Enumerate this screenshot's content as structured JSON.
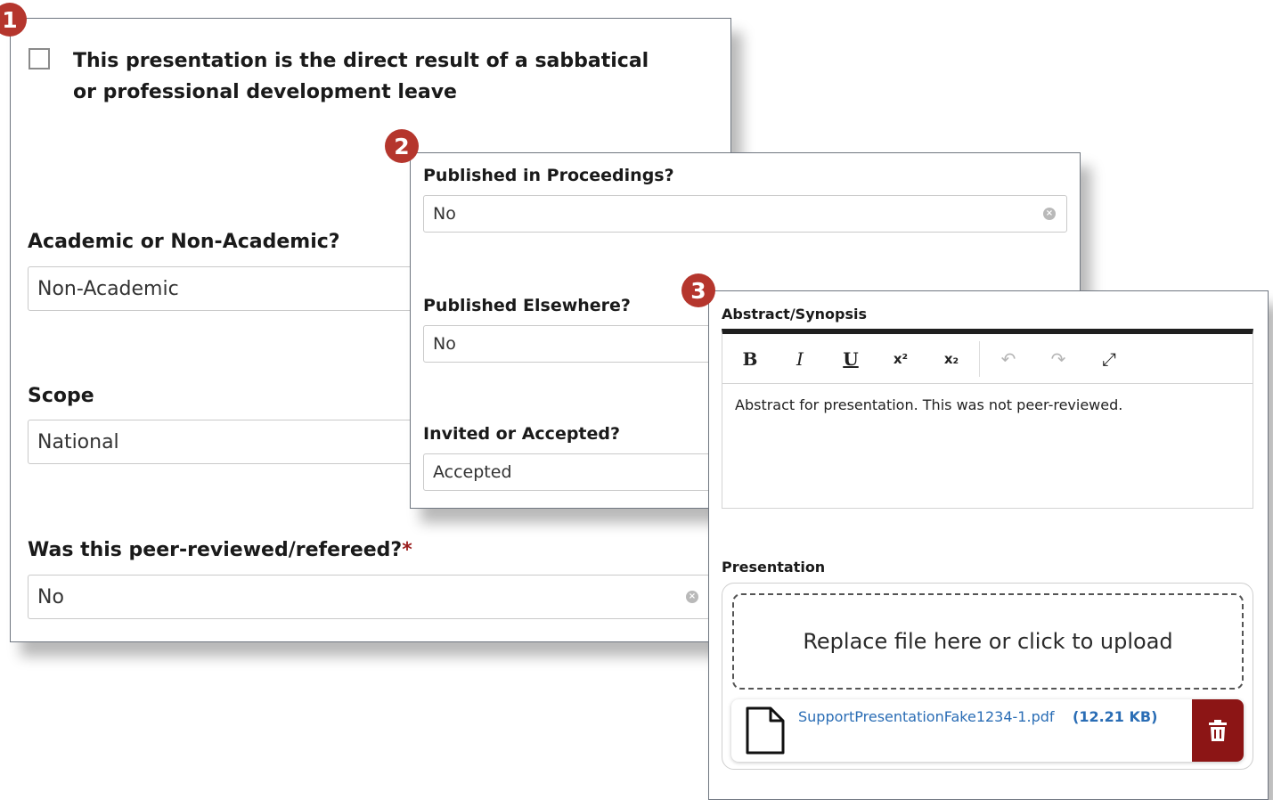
{
  "badges": [
    "1",
    "2",
    "3"
  ],
  "panel1": {
    "checkbox_label": "This presentation is the direct result of a sabbatical or professional development leave",
    "academic_label": "Academic or Non-Academic?",
    "academic_value": "Non-Academic",
    "scope_label": "Scope",
    "scope_value": "National",
    "peer_label": "Was this peer-reviewed/refereed?",
    "peer_required": "*",
    "peer_value": "No"
  },
  "panel2": {
    "proceedings_label": "Published in Proceedings?",
    "proceedings_value": "No",
    "elsewhere_label": "Published Elsewhere?",
    "elsewhere_value": "No",
    "invited_label": "Invited or Accepted?",
    "invited_value": "Accepted"
  },
  "panel3": {
    "abstract_label": "Abstract/Synopsis",
    "toolbar": {
      "bold": "B",
      "italic": "I",
      "underline": "U",
      "superscript": "x²",
      "subscript": "x₂",
      "undo": "↶",
      "redo": "↷",
      "fullscreen": "⤢"
    },
    "abstract_text": "Abstract for presentation. This was not peer-reviewed.",
    "presentation_label": "Presentation",
    "dropzone_text": "Replace file here or click to upload",
    "file_name": "SupportPresentationFake1234-1.pdf",
    "file_size": "(12.21 KB)"
  },
  "colors": {
    "badge": "#b5362d",
    "delete": "#8c1515",
    "link": "#2a6db5",
    "required": "#9b1d1d"
  }
}
